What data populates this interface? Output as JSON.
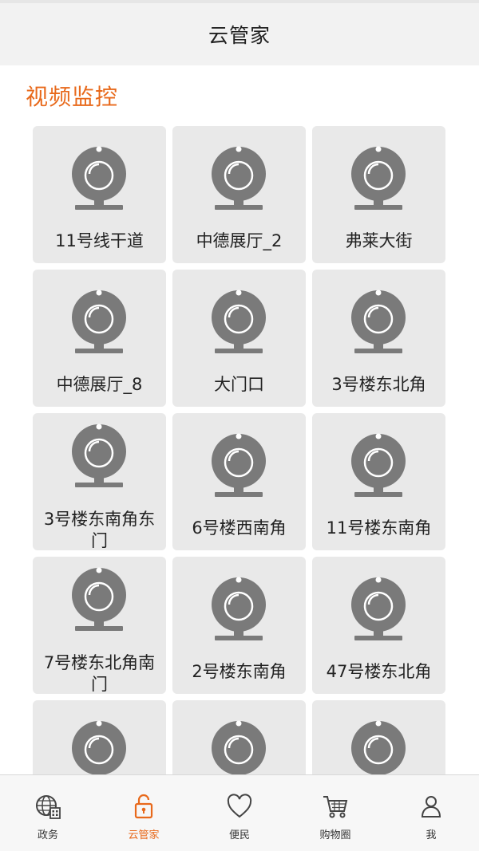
{
  "header": {
    "title": "云管家"
  },
  "section": {
    "title": "视频监控"
  },
  "cameras": [
    {
      "label": "11号线干道"
    },
    {
      "label": "中德展厅_2"
    },
    {
      "label": "弗莱大街"
    },
    {
      "label": "中德展厅_8"
    },
    {
      "label": "大门口"
    },
    {
      "label": "3号楼东北角"
    },
    {
      "label": "3号楼东南角东门"
    },
    {
      "label": "6号楼西南角"
    },
    {
      "label": "11号楼东南角"
    },
    {
      "label": "7号楼东北角南门"
    },
    {
      "label": "2号楼东南角"
    },
    {
      "label": "47号楼东北角"
    },
    {
      "label": ""
    },
    {
      "label": ""
    },
    {
      "label": ""
    }
  ],
  "tabs": [
    {
      "label": "政务",
      "icon": "globe-building-icon",
      "active": false
    },
    {
      "label": "云管家",
      "icon": "unlock-icon",
      "active": true
    },
    {
      "label": "便民",
      "icon": "heart-icon",
      "active": false
    },
    {
      "label": "购物圈",
      "icon": "cart-icon",
      "active": false
    },
    {
      "label": "我",
      "icon": "person-icon",
      "active": false
    }
  ],
  "colors": {
    "accent": "#e8691b",
    "camera": "#7a7a7a",
    "card": "#e9e9e9",
    "header": "#f2f2f2"
  }
}
